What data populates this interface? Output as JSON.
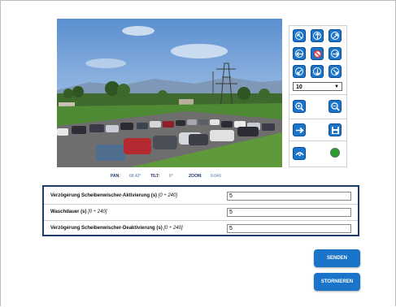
{
  "camera": {
    "pan_label": "PAN:",
    "pan_value": "68.42°",
    "tilt_label": "TILT:",
    "tilt_value": "0°",
    "zoom_label": "ZOOM:",
    "zoom_value": "9.04X"
  },
  "ptz": {
    "speed_selected": "10",
    "icons": [
      "arrow-up-left-icon",
      "arrow-up-icon",
      "arrow-up-right-icon",
      "arrow-left-icon",
      "stop-icon",
      "arrow-right-icon",
      "arrow-down-left-icon",
      "arrow-down-icon",
      "arrow-down-right-icon",
      "zoom-in-icon",
      "zoom-out-icon",
      "goto-preset-icon",
      "save-preset-icon",
      "wiper-icon",
      "status-led-icon"
    ],
    "status_color": "#2aa02a",
    "accent_color": "#1a74c9"
  },
  "form": {
    "rows": [
      {
        "label": "Verzögerung Scheibenwischer-Aktivierung (s)",
        "range": "[0 ÷ 240]",
        "value": "5"
      },
      {
        "label": "Waschdauer (s)",
        "range": "[0 ÷ 240]",
        "value": "5"
      },
      {
        "label": "Verzögerung Scheibenwischer-Deaktivierung (s)",
        "range": "[0 ÷ 240]",
        "value": "5"
      }
    ]
  },
  "actions": {
    "send": "SENDEN",
    "cancel": "STORNIEREN"
  }
}
